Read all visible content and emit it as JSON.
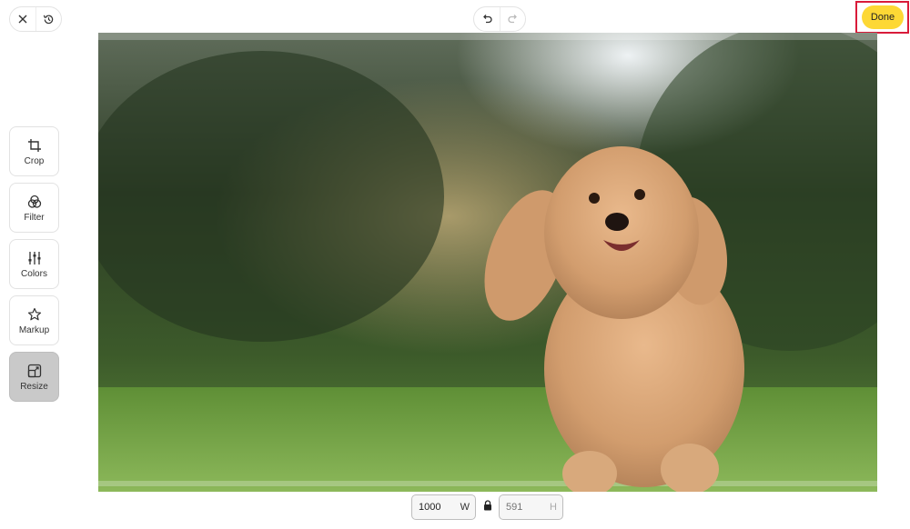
{
  "toolbar": {
    "close_icon": "close-icon",
    "history_icon": "history-icon",
    "undo_icon": "undo-icon",
    "redo_icon": "redo-icon",
    "done_label": "Done"
  },
  "tools": [
    {
      "label": "Crop",
      "icon": "crop-icon",
      "active": false
    },
    {
      "label": "Filter",
      "icon": "filter-icon",
      "active": false
    },
    {
      "label": "Colors",
      "icon": "sliders-icon",
      "active": false
    },
    {
      "label": "Markup",
      "icon": "star-icon",
      "active": false
    },
    {
      "label": "Resize",
      "icon": "resize-icon",
      "active": true
    }
  ],
  "size": {
    "width_value": "1000",
    "width_unit": "W",
    "height_placeholder": "591",
    "height_unit": "H",
    "lock_icon": "lock-icon"
  },
  "colors": {
    "accent": "#fdd835",
    "highlight_frame": "#d91b3a",
    "active_tool": "#c9c9c9"
  }
}
